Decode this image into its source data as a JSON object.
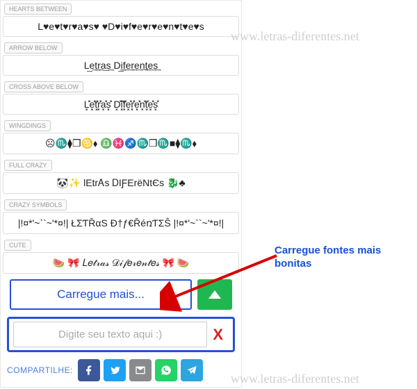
{
  "styles": [
    {
      "label": "HEARTS BETWEEN",
      "text": "L♥e♥t♥r♥a♥s♥ ♥D♥i♥f♥e♥r♥e♥n♥t♥e♥s"
    },
    {
      "label": "ARROW BELOW",
      "text": "L͢e͢t͢r͢a͢s͢ D͢i͢f͢e͢r͢e͢n͢t͢e͢s͢"
    },
    {
      "label": "CROSS ABOVE BELOW",
      "text": "L͓̽e͓̽t͓̽r͓̽a͓̽s͓̽ D͓̽i͓̽f͓̽e͓̽r͓̽e͓̽n͓̽t͓̽e͓̽s͓̽"
    },
    {
      "label": "WINGDINGS",
      "text": "☹♏⧫❒♋⬧ ♎♓♐♏❒♏■⧫♏⬧"
    },
    {
      "label": "FULL CRAZY",
      "text": "🐼✨ lEtrᎪs ᎠIƑЕrёNtЄs 🐉♣"
    },
    {
      "label": "CRAZY SYMBOLS",
      "text": "|!¤*'~``~'*¤!| ŁΣƬŘαS Ð†ƒ€ŘéռƬΣŜ |!¤*'~``~'*¤!|"
    },
    {
      "label": "CUTE",
      "text": "🍉 🎀 𝐿𝑒𝓉𝓇𝒶𝓈 𝒟𝒾𝒻𝑒𝓇𝑒𝓃𝓉𝑒𝓈 🎀 🍉"
    }
  ],
  "loadMore": "Carregue mais...",
  "input": {
    "placeholder": "Digite seu texto aqui :)"
  },
  "share": {
    "label": "COMPARTILHE:"
  },
  "watermark": "www.letras-diferentes.net",
  "callout": "Carregue fontes mais bonitas"
}
